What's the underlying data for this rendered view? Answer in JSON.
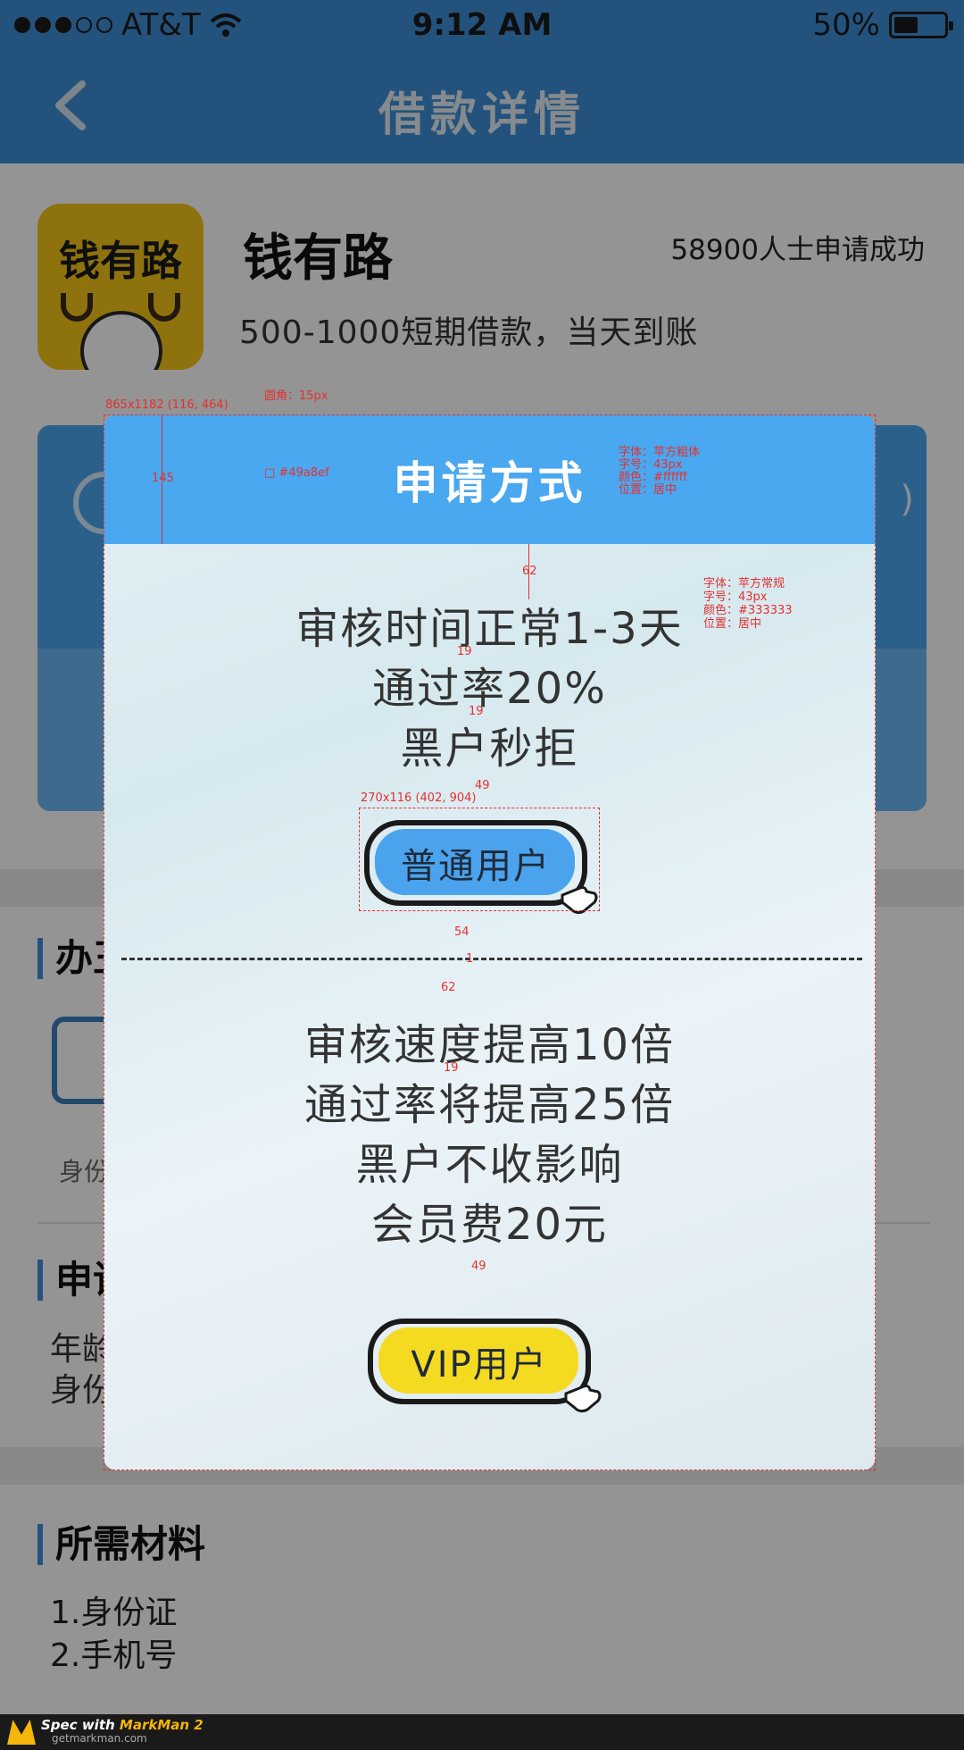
{
  "status_bar": {
    "carrier": "AT&T",
    "time": "9:12 AM",
    "battery": "50%",
    "battery_level": 0.5
  },
  "nav": {
    "title": "借款详情"
  },
  "app": {
    "name": "钱有路",
    "logo_text": "钱有路",
    "applicants": "58900人士申请成功",
    "description": "500-1000短期借款，当天到账"
  },
  "blue_card": {
    "trailing": ")"
  },
  "sections": {
    "process_title_partial": "办王",
    "id_label_partial": "身份",
    "apply_title_partial": "申请",
    "apply_line1": "年龄",
    "apply_line2": "身份",
    "materials_title": "所需材料",
    "materials": [
      "1.身份证",
      "2.手机号"
    ]
  },
  "modal": {
    "title": "申请方式",
    "normal_lines": [
      "审核时间正常1-3天",
      "通过率20%",
      "黑户秒拒"
    ],
    "normal_button": "普通用户",
    "vip_lines": [
      "审核速度提高10倍",
      "通过率将提高25倍",
      "黑户不收影响",
      "会员费20元"
    ],
    "vip_button": "VIP用户",
    "colors": {
      "header": "#49a8ef",
      "title_text": "#ffffff",
      "body_text": "#333333"
    }
  },
  "annotations": {
    "modal_size": "865x1182 (116, 464)",
    "corner": "圆角：15px",
    "header_height": "145",
    "header_color": "#49a8ef",
    "title_spec": [
      "字体：苹方粗体",
      "字号：43px",
      "颜色：#ffffff",
      "位置：居中"
    ],
    "body_spec": [
      "字体：苹方常规",
      "字号：43px",
      "颜色：#333333",
      "位置：居中"
    ],
    "gap_62a": "62",
    "gap_19a": "19",
    "gap_19b": "19",
    "gap_49a": "49",
    "button_size": "270x116 (402, 904)",
    "gap_54": "54",
    "gap_1": "1",
    "gap_62b": "62",
    "gap_19c": "19",
    "gap_49b": "49"
  },
  "footer": {
    "brand": "Spec with",
    "brand_name": "MarkMan 2",
    "url": "getmarkman.com"
  }
}
